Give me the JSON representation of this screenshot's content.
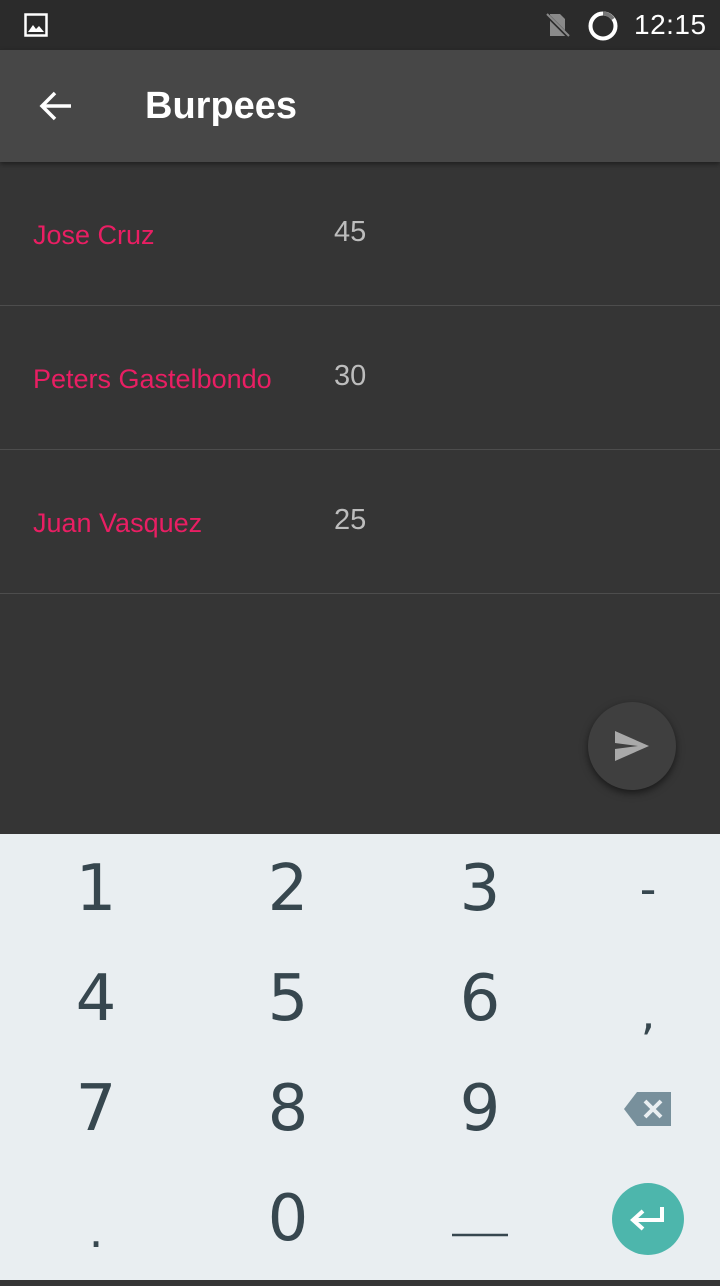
{
  "status_bar": {
    "time": "12:15",
    "icons": [
      "image-icon",
      "no-sim-icon",
      "sync-icon"
    ]
  },
  "app_bar": {
    "title": "Burpees",
    "back_icon": "arrow-back-icon"
  },
  "list": {
    "items": [
      {
        "name": "Jose Cruz",
        "value": "45"
      },
      {
        "name": "Peters Gastelbondo",
        "value": "30"
      },
      {
        "name": "Juan Vasquez",
        "value": "25"
      }
    ]
  },
  "fab": {
    "icon": "send-icon"
  },
  "keyboard": {
    "keys": [
      "1",
      "2",
      "3",
      "-",
      "4",
      "5",
      "6",
      ",",
      "7",
      "8",
      "9",
      "backspace",
      ".",
      "0",
      "_",
      "enter"
    ]
  },
  "colors": {
    "accent": "#e91e63",
    "enter_key": "#4db6ac",
    "background": "#353535",
    "app_bar": "#474747"
  }
}
